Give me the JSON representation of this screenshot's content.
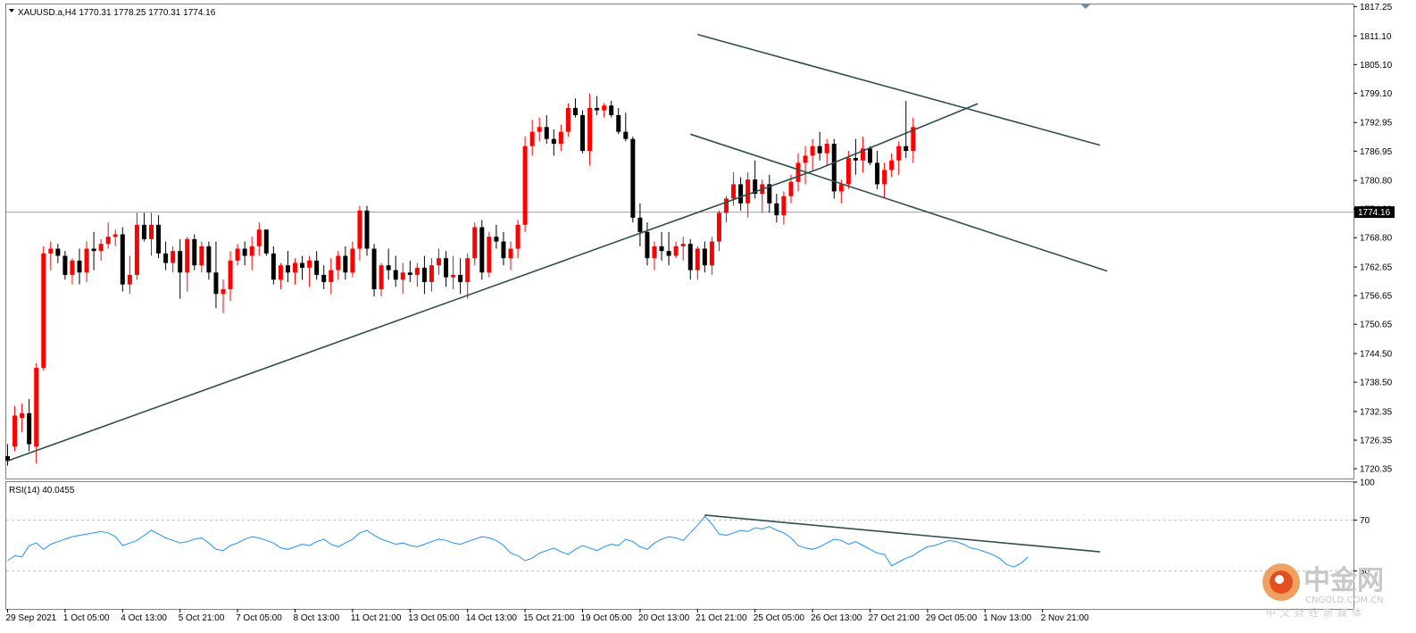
{
  "header": {
    "symbol_line": "XAUUSD.a,H4  1770.31 1778.25 1770.31 1774.16",
    "rsi_label": "RSI(14) 40.0455"
  },
  "current_price_label": "1774.16",
  "watermark": {
    "cn": "中金网",
    "en": "CNGOLD.COM.CN",
    "sub": "中文财经新媒体"
  },
  "colors": {
    "bull": "#ff0000",
    "bear": "#000000",
    "trendline": "#2f4f4f",
    "rsi": "#1e90ff",
    "grid_dash": "#c0c0c0",
    "price_line": "#a0a0a0"
  },
  "chart_data": [
    {
      "type": "candlestick",
      "title": "XAUUSD.a,H4",
      "header_values": {
        "open": 1770.31,
        "high": 1778.25,
        "low": 1770.31,
        "close": 1774.16
      },
      "ylim": [
        1718.3,
        1817.7
      ],
      "y_ticks": [
        "1817.25",
        "1811.10",
        "1805.10",
        "1799.10",
        "1792.95",
        "1786.95",
        "1780.80",
        "1774.80",
        "1768.80",
        "1762.65",
        "1756.65",
        "1750.65",
        "1744.50",
        "1738.50",
        "1732.35",
        "1726.35",
        "1720.35"
      ],
      "x_ticks": [
        "29 Sep 2021",
        "1 Oct 05:00",
        "4 Oct 13:00",
        "5 Oct 21:00",
        "7 Oct 05:00",
        "8 Oct 13:00",
        "11 Oct 21:00",
        "13 Oct 05:00",
        "14 Oct 13:00",
        "15 Oct 21:00",
        "19 Oct 05:00",
        "20 Oct 13:00",
        "21 Oct 21:00",
        "25 Oct 05:00",
        "26 Oct 13:00",
        "27 Oct 21:00",
        "29 Oct 05:00",
        "1 Nov 13:00",
        "2 Nov 21:00"
      ],
      "x_tick_bars": [
        0,
        8,
        16,
        24,
        32,
        40,
        48,
        56,
        64,
        72,
        80,
        88,
        96,
        104,
        112,
        120,
        128,
        136,
        144
      ],
      "last_price": 1774.16,
      "candles": [
        [
          1723.0,
          1725.5,
          1721.0,
          1722.0
        ],
        [
          1725.0,
          1733.5,
          1724.0,
          1731.5
        ],
        [
          1731.0,
          1734.0,
          1728.0,
          1732.0
        ],
        [
          1732.0,
          1735.0,
          1724.0,
          1725.5
        ],
        [
          1725.0,
          1742.5,
          1721.5,
          1741.5
        ],
        [
          1741.5,
          1767.0,
          1741.0,
          1765.5
        ],
        [
          1765.5,
          1768.0,
          1762.0,
          1766.5
        ],
        [
          1766.5,
          1767.5,
          1763.5,
          1765.0
        ],
        [
          1765.0,
          1766.0,
          1760.0,
          1761.0
        ],
        [
          1761.0,
          1764.5,
          1759.0,
          1764.0
        ],
        [
          1764.0,
          1766.5,
          1759.0,
          1761.5
        ],
        [
          1761.5,
          1768.0,
          1759.5,
          1766.5
        ],
        [
          1766.5,
          1770.0,
          1762.0,
          1766.0
        ],
        [
          1766.0,
          1768.5,
          1764.0,
          1767.5
        ],
        [
          1767.5,
          1772.0,
          1766.5,
          1769.0
        ],
        [
          1769.0,
          1770.5,
          1767.0,
          1769.5
        ],
        [
          1769.5,
          1771.0,
          1757.5,
          1759.0
        ],
        [
          1759.0,
          1765.0,
          1757.0,
          1761.0
        ],
        [
          1761.0,
          1774.0,
          1760.0,
          1771.5
        ],
        [
          1771.5,
          1774.0,
          1768.0,
          1768.5
        ],
        [
          1768.5,
          1774.0,
          1765.0,
          1771.5
        ],
        [
          1771.5,
          1773.5,
          1764.5,
          1765.5
        ],
        [
          1765.5,
          1768.0,
          1762.0,
          1763.5
        ],
        [
          1763.5,
          1767.0,
          1761.5,
          1766.0
        ],
        [
          1766.0,
          1768.5,
          1756.0,
          1761.5
        ],
        [
          1761.5,
          1769.0,
          1757.5,
          1768.5
        ],
        [
          1768.5,
          1769.5,
          1762.0,
          1763.0
        ],
        [
          1763.0,
          1768.0,
          1761.5,
          1767.0
        ],
        [
          1767.0,
          1768.0,
          1760.0,
          1761.5
        ],
        [
          1761.5,
          1768.0,
          1754.0,
          1757.0
        ],
        [
          1757.0,
          1760.0,
          1753.0,
          1758.0
        ],
        [
          1758.0,
          1766.0,
          1755.5,
          1764.0
        ],
        [
          1764.0,
          1767.5,
          1763.0,
          1766.5
        ],
        [
          1766.5,
          1768.0,
          1763.0,
          1765.0
        ],
        [
          1765.0,
          1769.0,
          1762.0,
          1767.0
        ],
        [
          1767.0,
          1772.0,
          1765.0,
          1770.5
        ],
        [
          1770.5,
          1770.5,
          1765.0,
          1765.5
        ],
        [
          1765.5,
          1767.0,
          1759.0,
          1760.0
        ],
        [
          1760.0,
          1763.5,
          1758.0,
          1763.0
        ],
        [
          1763.0,
          1766.0,
          1759.5,
          1761.5
        ],
        [
          1761.5,
          1764.5,
          1759.0,
          1763.5
        ],
        [
          1763.5,
          1765.0,
          1760.0,
          1762.5
        ],
        [
          1762.5,
          1765.0,
          1758.5,
          1764.0
        ],
        [
          1764.0,
          1766.0,
          1760.0,
          1761.0
        ],
        [
          1761.0,
          1763.0,
          1758.0,
          1759.5
        ],
        [
          1759.5,
          1764.5,
          1757.0,
          1762.0
        ],
        [
          1762.0,
          1766.0,
          1760.0,
          1765.0
        ],
        [
          1765.0,
          1767.0,
          1760.0,
          1761.5
        ],
        [
          1761.5,
          1768.0,
          1760.5,
          1766.5
        ],
        [
          1766.5,
          1775.5,
          1764.0,
          1774.5
        ],
        [
          1774.5,
          1775.5,
          1765.0,
          1766.5
        ],
        [
          1766.5,
          1767.5,
          1756.5,
          1758.0
        ],
        [
          1758.0,
          1763.5,
          1756.5,
          1763.0
        ],
        [
          1763.0,
          1766.5,
          1760.0,
          1762.0
        ],
        [
          1762.0,
          1765.0,
          1758.5,
          1760.0
        ],
        [
          1760.0,
          1763.5,
          1757.0,
          1761.5
        ],
        [
          1761.5,
          1764.0,
          1759.5,
          1761.0
        ],
        [
          1761.0,
          1763.5,
          1758.5,
          1762.5
        ],
        [
          1762.5,
          1765.0,
          1757.0,
          1759.5
        ],
        [
          1759.5,
          1764.5,
          1757.5,
          1763.0
        ],
        [
          1763.0,
          1766.5,
          1761.0,
          1764.5
        ],
        [
          1764.5,
          1766.0,
          1758.5,
          1760.5
        ],
        [
          1760.5,
          1765.0,
          1758.0,
          1761.0
        ],
        [
          1761.0,
          1764.5,
          1757.0,
          1759.5
        ],
        [
          1759.5,
          1765.5,
          1756.0,
          1764.5
        ],
        [
          1764.5,
          1772.0,
          1763.0,
          1771.0
        ],
        [
          1771.0,
          1772.5,
          1760.0,
          1761.5
        ],
        [
          1761.5,
          1770.0,
          1760.5,
          1769.0
        ],
        [
          1769.0,
          1771.5,
          1766.5,
          1768.0
        ],
        [
          1768.0,
          1770.0,
          1763.0,
          1764.5
        ],
        [
          1764.5,
          1768.0,
          1762.0,
          1766.5
        ],
        [
          1766.5,
          1772.5,
          1764.5,
          1771.5
        ],
        [
          1771.5,
          1790.0,
          1770.0,
          1788.0
        ],
        [
          1788.0,
          1793.5,
          1786.0,
          1791.0
        ],
        [
          1791.0,
          1794.0,
          1789.0,
          1792.0
        ],
        [
          1792.0,
          1794.5,
          1788.5,
          1789.5
        ],
        [
          1789.5,
          1791.5,
          1786.0,
          1788.5
        ],
        [
          1788.5,
          1792.5,
          1787.0,
          1791.0
        ],
        [
          1791.0,
          1797.0,
          1790.0,
          1796.0
        ],
        [
          1796.0,
          1798.0,
          1794.0,
          1794.5
        ],
        [
          1794.5,
          1795.5,
          1786.5,
          1787.0
        ],
        [
          1787.0,
          1799.0,
          1784.0,
          1796.0
        ],
        [
          1796.0,
          1798.5,
          1794.5,
          1795.5
        ],
        [
          1795.5,
          1797.0,
          1794.0,
          1796.5
        ],
        [
          1796.5,
          1797.5,
          1794.0,
          1794.5
        ],
        [
          1794.5,
          1796.0,
          1790.5,
          1791.0
        ],
        [
          1791.0,
          1795.0,
          1789.0,
          1789.5
        ],
        [
          1789.5,
          1790.0,
          1772.0,
          1773.0
        ],
        [
          1773.0,
          1776.0,
          1767.0,
          1770.0
        ],
        [
          1770.0,
          1772.0,
          1763.0,
          1764.5
        ],
        [
          1764.5,
          1768.0,
          1762.0,
          1767.0
        ],
        [
          1767.0,
          1770.0,
          1764.0,
          1766.0
        ],
        [
          1766.0,
          1770.0,
          1763.0,
          1765.0
        ],
        [
          1765.0,
          1768.0,
          1764.5,
          1767.0
        ],
        [
          1767.0,
          1769.0,
          1764.0,
          1767.5
        ],
        [
          1767.5,
          1768.5,
          1760.0,
          1762.0
        ],
        [
          1762.0,
          1767.0,
          1760.0,
          1766.5
        ],
        [
          1766.5,
          1768.0,
          1761.5,
          1763.0
        ],
        [
          1763.0,
          1769.0,
          1761.0,
          1768.0
        ],
        [
          1768.0,
          1774.5,
          1766.0,
          1774.0
        ],
        [
          1774.0,
          1777.5,
          1772.0,
          1777.0
        ],
        [
          1777.0,
          1782.5,
          1775.5,
          1780.0
        ],
        [
          1780.0,
          1781.5,
          1774.5,
          1776.0
        ],
        [
          1776.0,
          1782.5,
          1773.0,
          1781.0
        ],
        [
          1781.0,
          1785.0,
          1777.0,
          1778.0
        ],
        [
          1778.0,
          1781.0,
          1774.0,
          1780.0
        ],
        [
          1780.0,
          1782.0,
          1774.0,
          1776.0
        ],
        [
          1776.0,
          1778.0,
          1772.0,
          1773.5
        ],
        [
          1773.5,
          1778.5,
          1771.5,
          1777.5
        ],
        [
          1777.5,
          1782.0,
          1776.0,
          1780.5
        ],
        [
          1780.5,
          1786.5,
          1778.5,
          1784.5
        ],
        [
          1784.5,
          1788.0,
          1780.0,
          1786.0
        ],
        [
          1786.0,
          1789.5,
          1783.0,
          1788.0
        ],
        [
          1788.0,
          1791.0,
          1785.0,
          1786.5
        ],
        [
          1786.5,
          1789.5,
          1784.0,
          1788.5
        ],
        [
          1788.5,
          1789.5,
          1777.0,
          1778.5
        ],
        [
          1778.5,
          1781.0,
          1776.0,
          1780.0
        ],
        [
          1780.0,
          1787.0,
          1779.0,
          1785.5
        ],
        [
          1785.5,
          1789.5,
          1782.0,
          1785.0
        ],
        [
          1785.0,
          1790.0,
          1782.5,
          1787.5
        ],
        [
          1787.5,
          1788.0,
          1784.0,
          1784.5
        ],
        [
          1784.5,
          1787.0,
          1779.0,
          1780.0
        ],
        [
          1780.0,
          1784.5,
          1777.0,
          1783.0
        ],
        [
          1783.0,
          1786.5,
          1781.5,
          1785.0
        ],
        [
          1785.0,
          1789.0,
          1782.0,
          1788.0
        ],
        [
          1788.0,
          1797.5,
          1785.5,
          1787.0
        ],
        [
          1787.0,
          1794.0,
          1784.5,
          1792.0
        ]
      ],
      "trendlines": [
        {
          "from": [
            0,
            1722.0
          ],
          "to": [
            113,
            1783.3
          ]
        },
        {
          "from": [
            96,
            1811.4
          ],
          "to": [
            152,
            1788.2
          ]
        },
        {
          "from": [
            95,
            1790.5
          ],
          "to": [
            153,
            1761.8
          ]
        },
        {
          "from": [
            113,
            1783.3
          ],
          "to": [
            135,
            1796.9
          ]
        }
      ]
    },
    {
      "type": "line",
      "title": "RSI(14) 40.0455",
      "ylim": [
        0,
        100
      ],
      "y_ticks": [
        "100",
        "70",
        "30"
      ],
      "levels": [
        70,
        30
      ],
      "values": [
        38,
        42,
        41,
        50,
        52,
        47,
        51,
        53,
        55,
        57,
        58,
        59,
        60,
        61,
        60,
        57,
        50,
        52,
        54,
        58,
        62,
        59,
        56,
        54,
        52,
        53,
        55,
        56,
        52,
        47,
        46,
        50,
        52,
        55,
        57,
        56,
        54,
        52,
        48,
        47,
        49,
        51,
        50,
        53,
        55,
        51,
        49,
        52,
        55,
        60,
        62,
        58,
        55,
        53,
        51,
        52,
        50,
        49,
        51,
        53,
        55,
        54,
        52,
        51,
        53,
        55,
        57,
        56,
        54,
        50,
        44,
        42,
        38,
        40,
        44,
        46,
        48,
        45,
        43,
        47,
        50,
        48,
        46,
        49,
        51,
        50,
        55,
        53,
        49,
        47,
        52,
        55,
        57,
        56,
        54,
        60,
        66,
        73,
        67,
        59,
        58,
        60,
        62,
        61,
        64,
        63,
        65,
        62,
        60,
        56,
        50,
        48,
        47,
        49,
        52,
        55,
        54,
        51,
        53,
        50,
        47,
        44,
        43,
        34,
        37,
        40,
        42,
        46,
        49,
        50,
        52,
        54,
        53,
        51,
        48,
        47,
        45,
        43,
        40,
        35,
        33,
        36,
        41
      ],
      "trendlines": [
        {
          "from": [
            97,
            74.0
          ],
          "to": [
            152,
            45.0
          ]
        }
      ]
    }
  ]
}
